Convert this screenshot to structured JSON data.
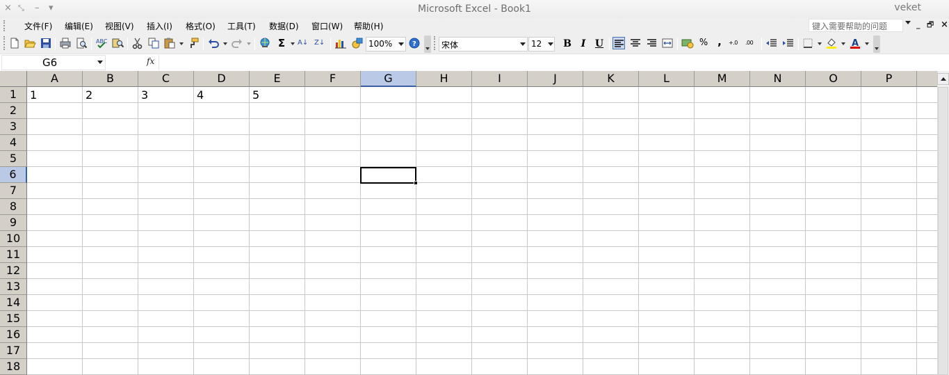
{
  "window": {
    "title": "Microsoft Excel - Book1",
    "user": "veket",
    "controls": {
      "close": "×",
      "restore": "⤡",
      "minimize": "–",
      "menu": "▾"
    }
  },
  "menu": {
    "items": [
      "文件(F)",
      "编辑(E)",
      "视图(V)",
      "插入(I)",
      "格式(O)",
      "工具(T)",
      "数据(D)",
      "窗口(W)",
      "帮助(H)"
    ],
    "help_placeholder": "键入需要帮助的问题",
    "doc_controls": {
      "minimize": "_",
      "restore": "🗗",
      "close": "×"
    }
  },
  "toolbar": {
    "zoom": "100%",
    "font_name": "宋体",
    "font_size": "12",
    "bold_label": "B",
    "italic_label": "I",
    "underline_label": "U",
    "percent_label": "%",
    "comma_label": ",",
    "increase_decimal_label": "+.0",
    "decrease_decimal_label": ".00",
    "sigma_label": "Σ",
    "sort_asc_label": "A↓",
    "sort_desc_label": "Z↓",
    "font_color": "#e00000",
    "fill_color": "#ffee00"
  },
  "formula_bar": {
    "name_box": "G6",
    "fx_label": "fx",
    "formula": ""
  },
  "sheet": {
    "columns": [
      "A",
      "B",
      "C",
      "D",
      "E",
      "F",
      "G",
      "H",
      "I",
      "J",
      "K",
      "L",
      "M",
      "N",
      "O",
      "P"
    ],
    "rows": [
      "1",
      "2",
      "3",
      "4",
      "5",
      "6",
      "7",
      "8",
      "9",
      "10",
      "11",
      "12",
      "13",
      "14",
      "15",
      "16",
      "17",
      "18"
    ],
    "selected_column": "G",
    "selected_row": "6",
    "row1_values": [
      "1",
      "2",
      "3",
      "4",
      "5"
    ]
  }
}
